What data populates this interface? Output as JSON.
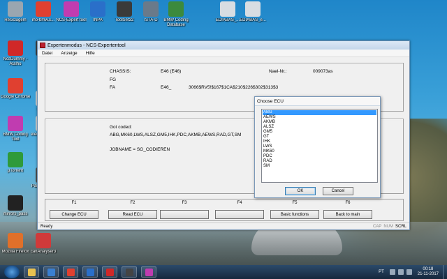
{
  "desktop_icons": [
    {
      "label": "Reciclagem",
      "color": "#9aa6b0"
    },
    {
      "label": "iho-bmw.s...",
      "color": "#e04030"
    },
    {
      "label": "NCS-Expert tool",
      "color": "#c03cb0"
    },
    {
      "label": "INPA",
      "color": "#2a6fc9"
    },
    {
      "label": "ToolSet32",
      "color": "#3a3a3a"
    },
    {
      "label": "ISTA-D",
      "color": "#6a7a8a"
    },
    {
      "label": "BMW Coding Database",
      "color": "#3c8a3c"
    },
    {
      "label": "EDIABAS_...",
      "color": "#d8dde2"
    },
    {
      "label": "EDIABAS_e...",
      "color": "#d8dde2"
    },
    {
      "label": "NcsDummy - Atalho",
      "color": "#d02828"
    },
    {
      "label": "FT...",
      "color": "#444444"
    },
    {
      "label": "Google Chrome",
      "color": "#e04030"
    },
    {
      "label": "chan...",
      "color": "#dddddd"
    },
    {
      "label": "BMW Coding Tool",
      "color": "#c03cb0"
    },
    {
      "label": "electr... esq...",
      "color": "#dddddd"
    },
    {
      "label": "µTorrent",
      "color": "#2f9a3a"
    },
    {
      "label": "Pai... Detal...",
      "color": "#555555"
    },
    {
      "label": "mirrors_pass",
      "color": "#222222"
    },
    {
      "label": "Mozilla Firefox",
      "color": "#e0702a"
    },
    {
      "label": "canAnalyser3",
      "color": "#d03a3a"
    }
  ],
  "window": {
    "title": "Expertenmodus - NCS-Expertentool",
    "menu": [
      "Datei",
      "Anzeige",
      "Hilfe"
    ],
    "chassis_label": "CHASSIS:",
    "chassis_value": "E46 (E46)",
    "naelnr_label": "Nael-Nr.:",
    "naelnr_value": "009073as",
    "fg_label": "FG",
    "fa_label": "FA",
    "fa_value_start": "E46_",
    "fa_value_end": "3066$RV5!$167$1CA$210$226$302$313$3",
    "got_coded_label": "Got coded:",
    "got_coded_value": "ABG,MK60,LWS,ALSZ,GM5,IHK,PDC,AKMB,AEWS,RAD,GT,SM",
    "jobname": "JOBNAME = SG_CODIEREN",
    "fkeys": [
      {
        "key": "F1",
        "label": "Change ECU"
      },
      {
        "key": "F2",
        "label": "Read ECU"
      },
      {
        "key": "F3",
        "label": ""
      },
      {
        "key": "F4",
        "label": ""
      },
      {
        "key": "F5",
        "label": "Basic functions"
      },
      {
        "key": "F6",
        "label": "Back to main"
      }
    ],
    "status": "Ready",
    "indicators": [
      "CAP",
      "NUM",
      "SCRL"
    ]
  },
  "dialog": {
    "title": "Choose ECU",
    "items": [
      "ABG",
      "AEWS",
      "AKMB",
      "ALSZ",
      "GM5",
      "GT",
      "IHK",
      "LWS",
      "MK60",
      "PDC",
      "RAD",
      "SM"
    ],
    "selected": "ABG",
    "ok_label": "OK",
    "cancel_label": "Cancel"
  },
  "taskbar": {
    "apps": [
      {
        "name": "explorer",
        "color": "#e8c050"
      },
      {
        "name": "media-player",
        "color": "#3a7fd0"
      },
      {
        "name": "chrome",
        "color": "#e04030"
      },
      {
        "name": "inpa",
        "color": "#2a6fc9"
      },
      {
        "name": "ncs-dummy",
        "color": "#d02828"
      },
      {
        "name": "toolset",
        "color": "#444444"
      },
      {
        "name": "coding-tool",
        "color": "#c03cb0"
      }
    ],
    "language": "PT",
    "time": "00:18",
    "date": "21-11-2017"
  }
}
